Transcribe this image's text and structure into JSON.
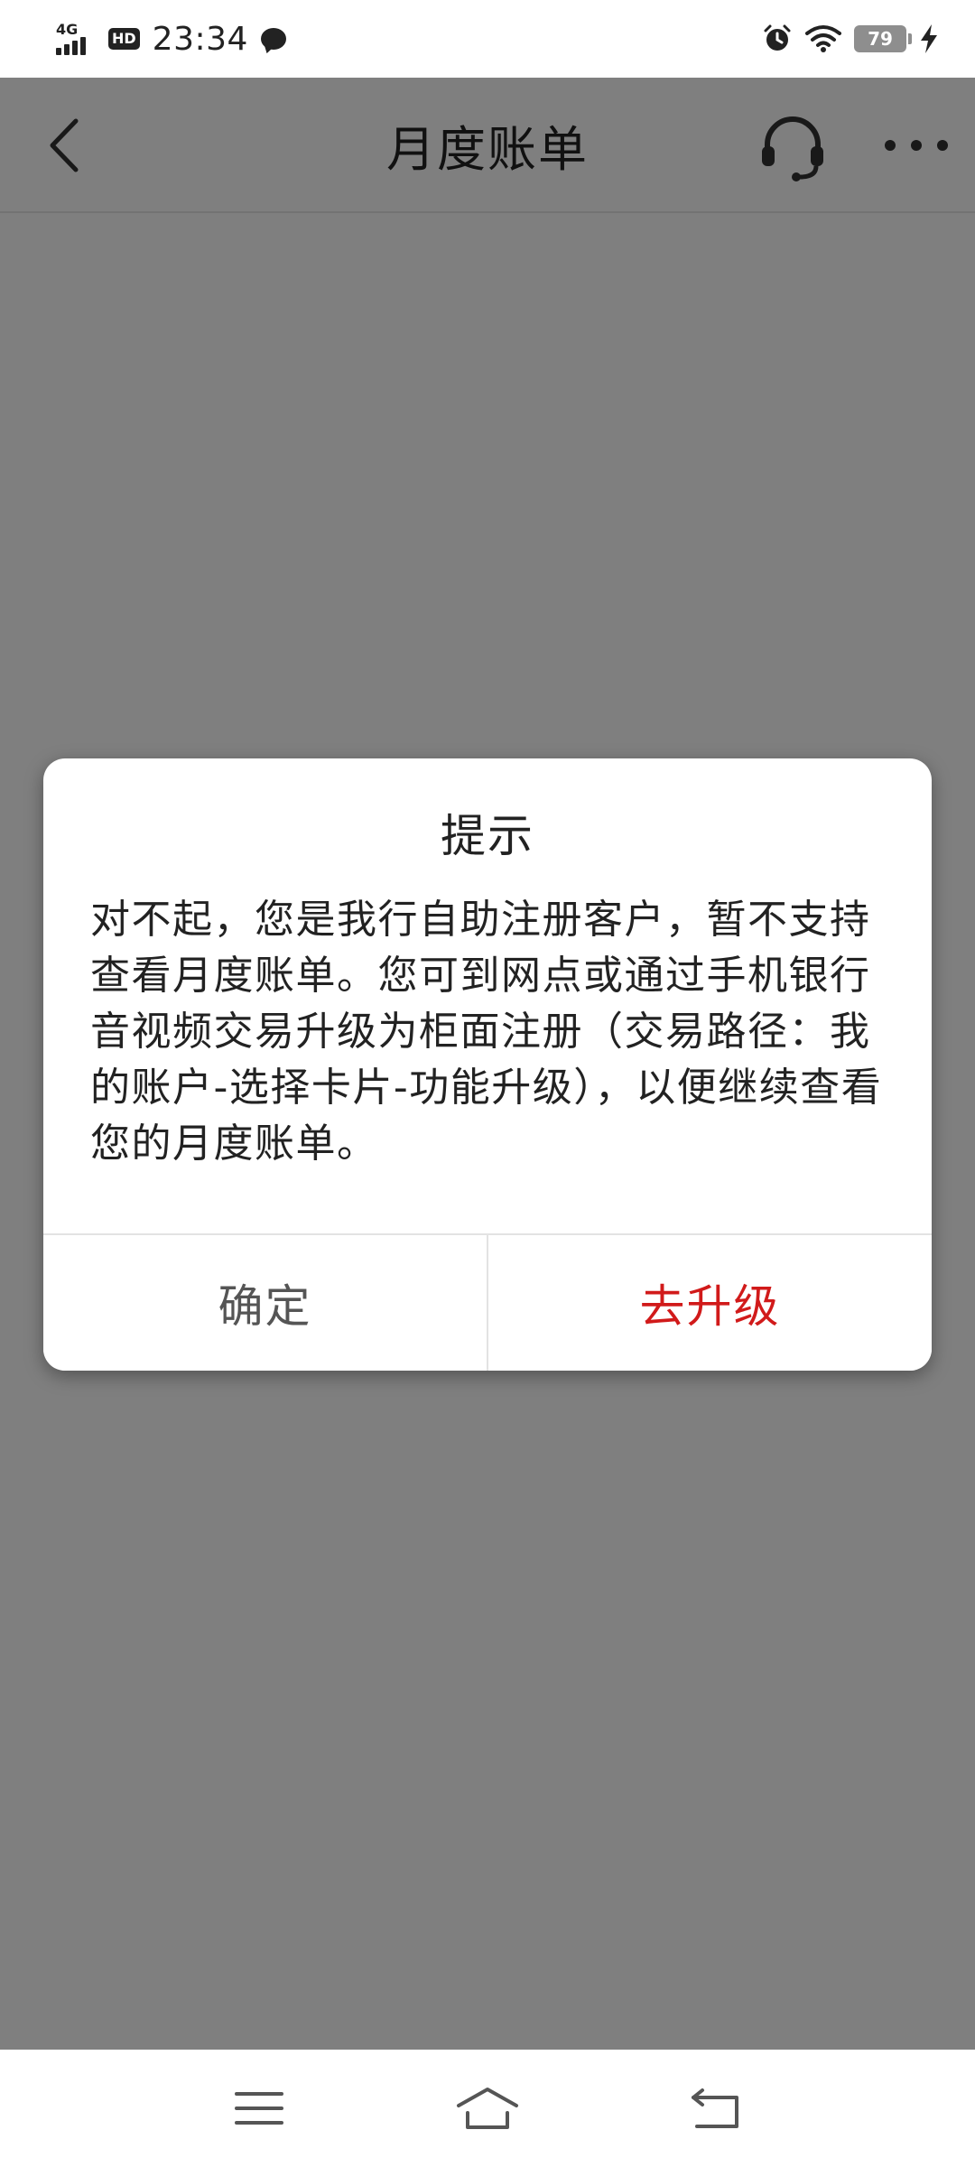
{
  "status_bar": {
    "network": "4G",
    "hd": "HD",
    "time": "23:34",
    "battery": "79"
  },
  "header": {
    "title": "月度账单"
  },
  "dialog": {
    "title": "提示",
    "message": "对不起，您是我行自助注册客户，暂不支持查看月度账单。您可到网点或通过手机银行音视频交易升级为柜面注册（交易路径：我的账户-选择卡片-功能升级），以便继续查看您的月度账单。",
    "confirm_label": "确定",
    "upgrade_label": "去升级"
  },
  "colors": {
    "accent": "#d11a1a",
    "overlay": "rgba(0,0,0,0.5)"
  },
  "icons": {
    "back": "chevron-left-icon",
    "support": "headset-icon",
    "more": "more-dots-icon",
    "nav_menu": "menu-icon",
    "nav_home": "home-icon",
    "nav_back": "back-arrow-icon"
  }
}
